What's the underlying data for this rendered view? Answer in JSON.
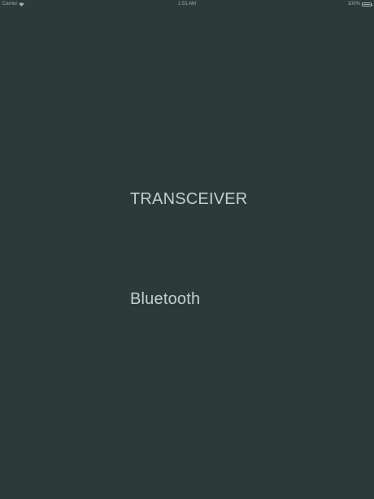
{
  "status_bar": {
    "carrier": "Carrier",
    "time": "1:51 AM",
    "battery": "100%",
    "battery_level": 1.0
  },
  "main": {
    "title": "TRANSCEIVER",
    "bluetooth_label": "Bluetooth"
  },
  "colors": {
    "background": "#2c3a3a",
    "text": "#c4cfcd",
    "status_text": "#9fb0ad"
  }
}
